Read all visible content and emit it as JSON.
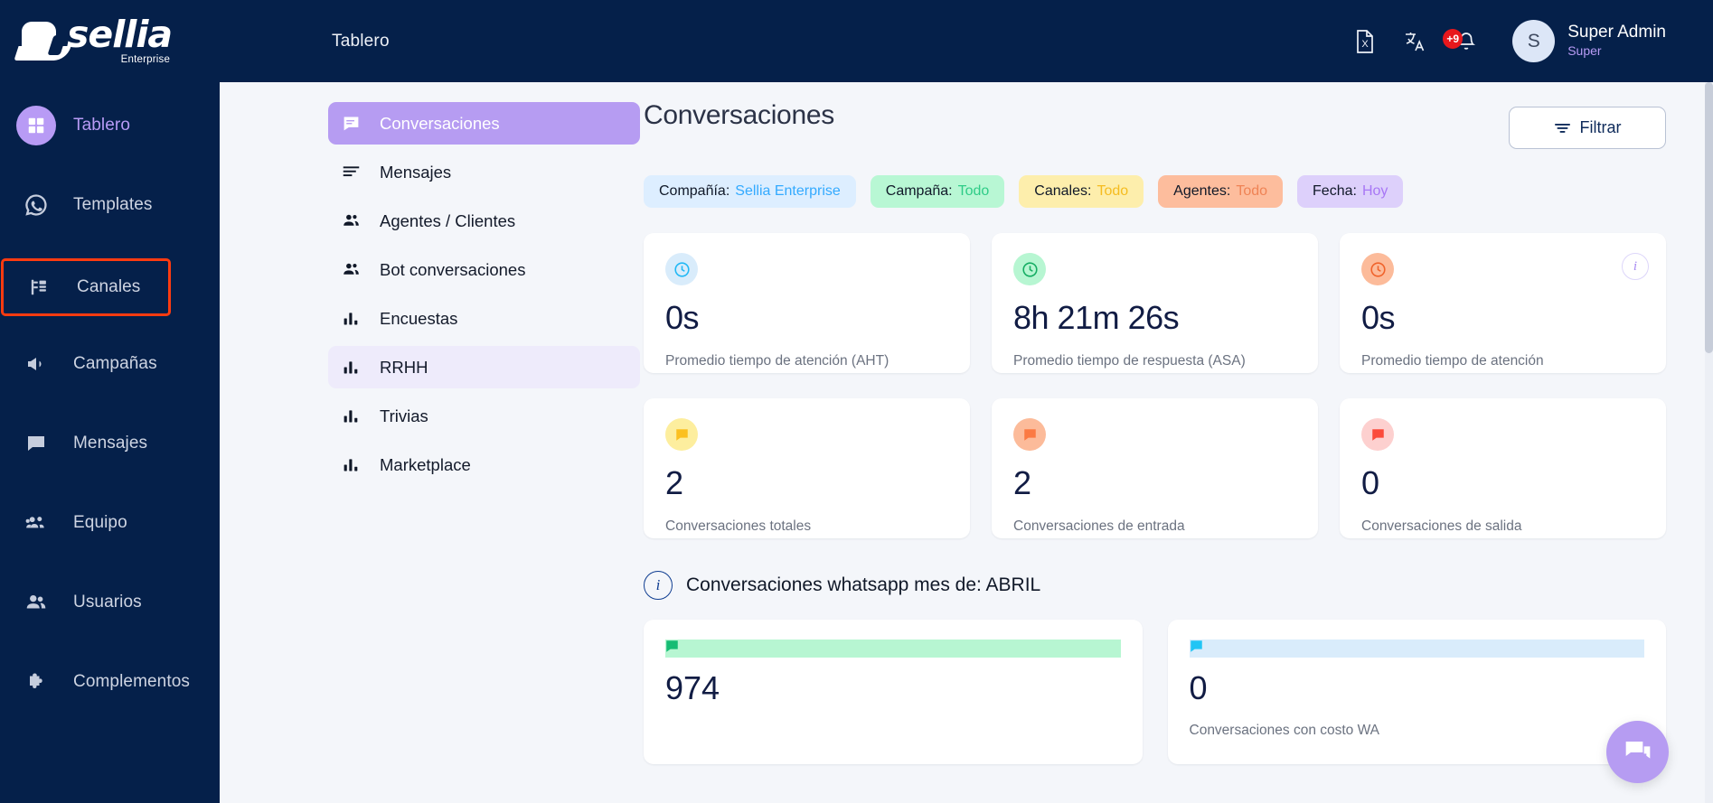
{
  "brand": {
    "name": "sellia",
    "sub": "Enterprise"
  },
  "rail": {
    "items": [
      {
        "label": "Tablero",
        "icon": "dashboard-icon",
        "state": "active"
      },
      {
        "label": "Templates",
        "icon": "whatsapp-icon",
        "state": ""
      },
      {
        "label": "Canales",
        "icon": "channels-icon",
        "state": "highlight"
      },
      {
        "label": "Campañas",
        "icon": "megaphone-icon",
        "state": ""
      },
      {
        "label": "Mensajes",
        "icon": "chat-icon",
        "state": ""
      },
      {
        "label": "Equipo",
        "icon": "team-icon",
        "state": ""
      },
      {
        "label": "Usuarios",
        "icon": "users-icon",
        "state": ""
      },
      {
        "label": "Complementos",
        "icon": "puzzle-icon",
        "state": ""
      }
    ]
  },
  "topbar": {
    "breadcrumb": "Tablero",
    "icons": [
      {
        "name": "excel-export-icon",
        "badge": ""
      },
      {
        "name": "translate-icon",
        "badge": ""
      },
      {
        "name": "notifications-bell-icon",
        "badge": "+9"
      }
    ],
    "user": {
      "initial": "S",
      "name": "Super Admin",
      "role": "Super"
    }
  },
  "menu": {
    "items": [
      {
        "label": "Conversaciones",
        "icon": "chat-box-icon",
        "state": "sel"
      },
      {
        "label": "Mensajes",
        "icon": "lines-icon",
        "state": ""
      },
      {
        "label": "Agentes / Clientes",
        "icon": "people-icon",
        "state": ""
      },
      {
        "label": "Bot conversaciones",
        "icon": "people-icon",
        "state": ""
      },
      {
        "label": "Encuestas",
        "icon": "bars-icon",
        "state": ""
      },
      {
        "label": "RRHH",
        "icon": "bars-icon",
        "state": "soft"
      },
      {
        "label": "Trivias",
        "icon": "bars-icon",
        "state": ""
      },
      {
        "label": "Marketplace",
        "icon": "bars-icon",
        "state": ""
      }
    ]
  },
  "page": {
    "title": "Conversaciones",
    "filter_label": "Filtrar"
  },
  "chips": [
    {
      "key": "Compañía:",
      "value": "Sellia Enterprise",
      "bg": "#ddeeff",
      "fg": "#33aaff"
    },
    {
      "key": "Campaña:",
      "value": "Todo",
      "bg": "#b8f7d4",
      "fg": "#2ecc87"
    },
    {
      "key": "Canales:",
      "value": "Todo",
      "bg": "#fdeeac",
      "fg": "#f5bc20"
    },
    {
      "key": "Agentes:",
      "value": "Todo",
      "bg": "#fdbd9d",
      "fg": "#ef8355"
    },
    {
      "key": "Fecha:",
      "value": "Hoy",
      "bg": "#ddd0fb",
      "fg": "#a877f5"
    }
  ],
  "cards_row1": [
    {
      "value": "0s",
      "label": "Promedio tiempo de atención (AHT)",
      "icon": "clock-icon",
      "icon_bg": "#d9ecfb",
      "icon_fg": "#21b8f5",
      "info": false
    },
    {
      "value": "8h 21m 26s",
      "label": "Promedio tiempo de respuesta (ASA)",
      "icon": "clock-icon",
      "icon_bg": "#b7f6d2",
      "icon_fg": "#14ad62",
      "info": false
    },
    {
      "value": "0s",
      "label": "Promedio tiempo de atención",
      "icon": "clock-icon",
      "icon_bg": "#fcbb9a",
      "icon_fg": "#f0622a",
      "info": true
    }
  ],
  "cards_row2": [
    {
      "value": "2",
      "label": "Conversaciones totales",
      "icon": "message-icon",
      "icon_bg": "#fdee9e",
      "icon_fg": "#fbc020",
      "info": false
    },
    {
      "value": "2",
      "label": "Conversaciones de entrada",
      "icon": "message-icon",
      "icon_bg": "#fcbb9a",
      "icon_fg": "#fb7a43",
      "info": false
    },
    {
      "value": "0",
      "label": "Conversaciones de salida",
      "icon": "message-icon",
      "icon_bg": "#fdd0cf",
      "icon_fg": "#fb4b3b",
      "info": false
    }
  ],
  "section": {
    "title": "Conversaciones whatsapp mes de: ABRIL",
    "info": "i"
  },
  "cards_wide": [
    {
      "value": "974",
      "label": "",
      "icon": "message-icon",
      "icon_bg": "#b7f6d2",
      "icon_fg": "#16bc74"
    },
    {
      "value": "0",
      "label": "Conversaciones con costo WA",
      "icon": "message-icon",
      "icon_bg": "#d9ecfb",
      "icon_fg": "#21c5f5"
    }
  ],
  "fab": {
    "name": "chat-fab",
    "color": "#b69cf2"
  }
}
